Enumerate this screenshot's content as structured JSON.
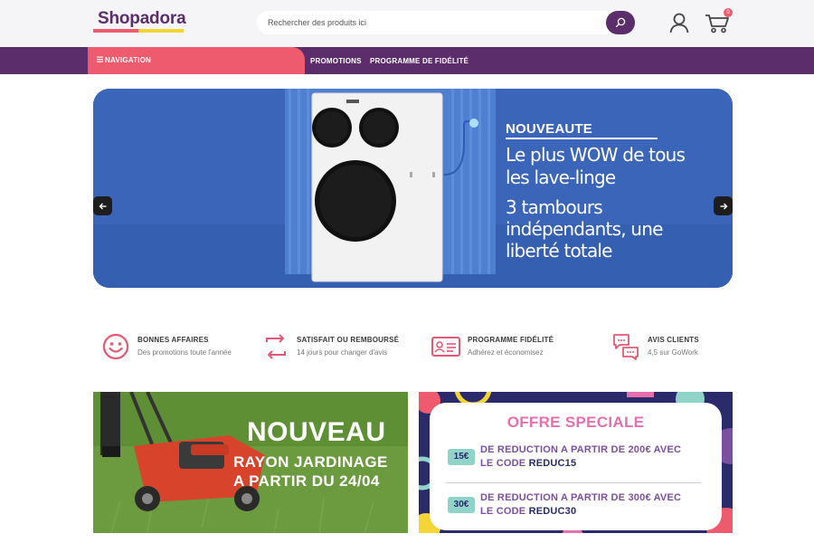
{
  "header": {
    "logo": "Shopadora",
    "search_placeholder": "Rechercher des produits ici",
    "cart_count": "0"
  },
  "nav": {
    "navigation_label": "NAVIGATION",
    "links": [
      "PROMOTIONS",
      "PROGRAMME DE FIDÉLITÉ"
    ]
  },
  "hero": {
    "tag": "NOUVEAUTE",
    "lines": [
      "Le plus WOW de tous",
      "les lave-linge",
      "3 tambours",
      "indépendants, une",
      "liberté totale"
    ]
  },
  "features": [
    {
      "title": "BONNES AFFAIRES",
      "subtitle": "Des promotions toute l'année",
      "icon": "smiley-icon"
    },
    {
      "title": "SATISFAIT OU REMBOURSÉ",
      "subtitle": "14 jours pour changer d'avis",
      "icon": "exchange-arrows-icon"
    },
    {
      "title": "PROGRAMME FIDÉLITÉ",
      "subtitle": "Adhérez et économisez",
      "icon": "member-card-icon"
    },
    {
      "title": "AVIS CLIENTS",
      "subtitle": "4,5 sur GoWork",
      "icon": "chat-bubbles-icon"
    }
  ],
  "garden_banner": {
    "title": "NOUVEAU",
    "line1": "RAYON JARDINAGE",
    "line2": "A PARTIR DU 24/04"
  },
  "offer_banner": {
    "title": "OFFRE SPECIALE",
    "offers": [
      {
        "amount": "15€",
        "line1": "DE REDUCTION A PARTIR DE 200€ AVEC",
        "line2_prefix": "LE CODE ",
        "code": "REDUC15"
      },
      {
        "amount": "30€",
        "line1": "DE REDUCTION A PARTIR DE 300€ AVEC",
        "line2_prefix": "LE CODE ",
        "code": "REDUC30"
      }
    ]
  },
  "colors": {
    "brand_purple": "#5b2d6b",
    "brand_pink": "#ef5b6e",
    "brand_yellow": "#f4d536",
    "hero_blue": "#3a65b8"
  }
}
